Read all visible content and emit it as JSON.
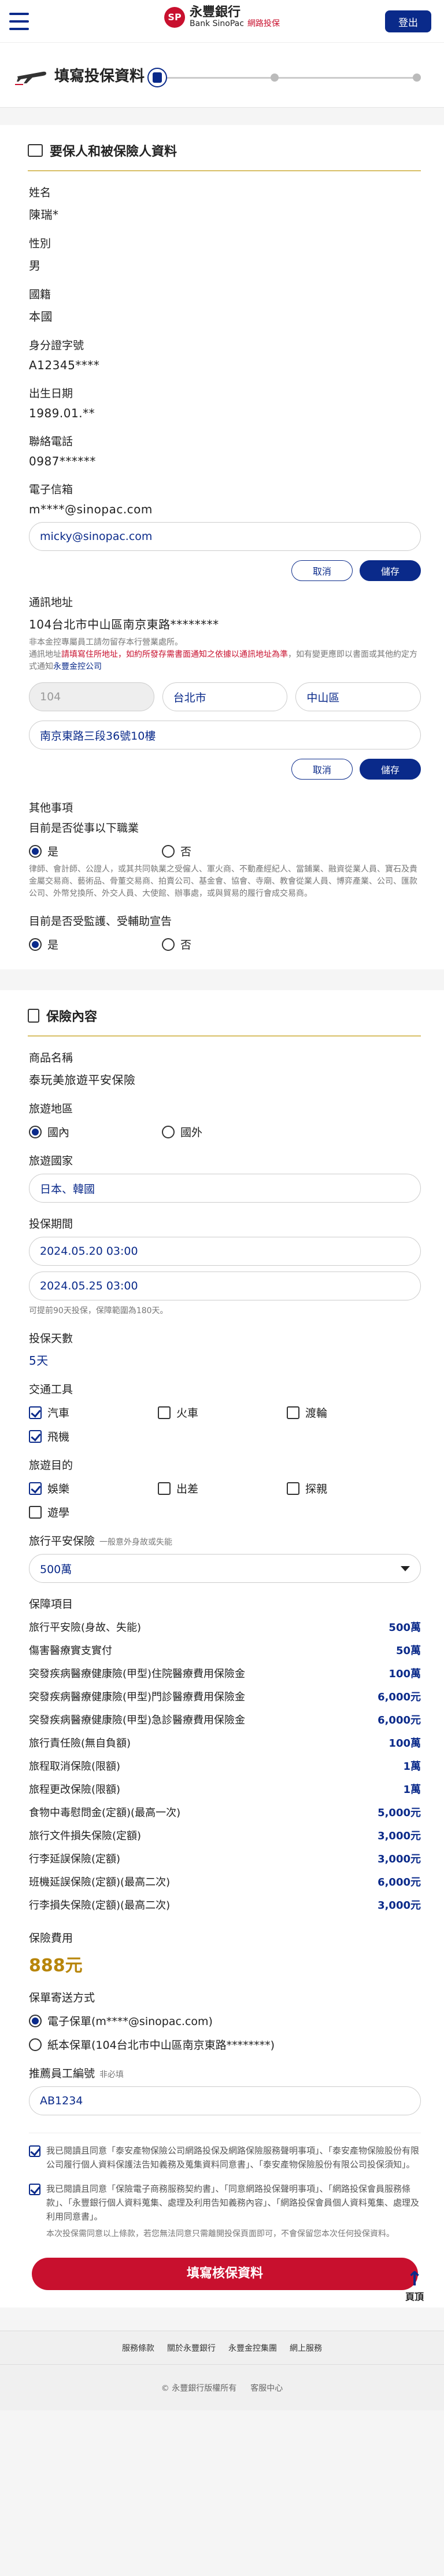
{
  "header": {
    "logo_mark": "SP",
    "bank_cn": "永豐銀行",
    "bank_en": "Bank SinoPac",
    "bank_sub": "網路投保",
    "logout": "登出"
  },
  "title": {
    "page_title": "填寫投保資料"
  },
  "applicant": {
    "section_title": "要保人和被保險人資料",
    "name_label": "姓名",
    "name": "陳瑞*",
    "gender_label": "性別",
    "gender": "男",
    "nationality_label": "國籍",
    "nationality": "本國",
    "id_label": "身分證字號",
    "id": "A12345****",
    "birth_label": "出生日期",
    "birth": "1989.01.**",
    "phone_label": "聯絡電話",
    "phone": "0987******",
    "email_label": "電子信箱",
    "email_masked": "m****@sinopac.com",
    "email_input": "micky@sinopac.com",
    "cancel": "取消",
    "save": "儲存",
    "address_label": "通訊地址",
    "address": "104台北市中山區南京東路********",
    "address_note1": "非本金控專屬員工請勿留存本行營業處所。",
    "address_note2": "通訊地址",
    "address_note_red": "請填寫住所地址，如約所發存需書面通知之依據以通訊地址為準",
    "address_note3": "，如有變更應即以書面或其他約定方式通知",
    "address_note_blue": "永豐金控公司",
    "postal": "104",
    "city": "台北市",
    "district": "中山區",
    "street": "南京東路三段36號10樓"
  },
  "other": {
    "title": "其他事項",
    "q1": "目前是否從事以下職業",
    "yes": "是",
    "no": "否",
    "q1_note": "律師、會計師、公證人，或其共同執業之受僱人、軍火商、不動產經紀人、當鋪業、融資從業人員、寶石及貴金屬交易商、藝術品、骨董交易商、拍賣公司、基金會、協會、寺廟、教會從業人員、博弈產業、公司、匯款公司、外幣兌換所、外交人員、大使館、辦事處，或與貿易的履行會成交易商。",
    "q2": "目前是否受監護、受輔助宣告"
  },
  "insurance": {
    "section_title": "保險內容",
    "product_label": "商品名稱",
    "product": "泰玩美旅遊平安保險",
    "region_label": "旅遊地區",
    "domestic": "國內",
    "abroad": "國外",
    "country_label": "旅遊國家",
    "country": "日本、韓國",
    "period_label": "投保期間",
    "start": "2024.05.20 03:00",
    "end": "2024.05.25 03:00",
    "period_note": "可提前90天投保，保障範圍為180天。",
    "days_label": "投保天數",
    "days": "5天",
    "transport_label": "交通工具",
    "transport": [
      {
        "label": "汽車",
        "on": true
      },
      {
        "label": "火車",
        "on": false
      },
      {
        "label": "渡輪",
        "on": false
      },
      {
        "label": "飛機",
        "on": true
      }
    ],
    "purpose_label": "旅遊目的",
    "purpose": [
      {
        "label": "娛樂",
        "on": true
      },
      {
        "label": "出差",
        "on": false
      },
      {
        "label": "探親",
        "on": false
      },
      {
        "label": "遊學",
        "on": false
      }
    ],
    "amount_label": "旅行平安保險",
    "amount_hint": "一般意外身故或失能",
    "amount": "500萬",
    "coverage_label": "保障項目",
    "coverage": [
      {
        "name": "旅行平安險(身故、失能)",
        "amt": "500萬"
      },
      {
        "name": "傷害醫療實支實付",
        "amt": "50萬"
      },
      {
        "name": "突發疾病醫療健康險(甲型)住院醫療費用保險金",
        "amt": "100萬"
      },
      {
        "name": "突發疾病醫療健康險(甲型)門診醫療費用保險金",
        "amt": "6,000元"
      },
      {
        "name": "突發疾病醫療健康險(甲型)急診醫療費用保險金",
        "amt": "6,000元"
      },
      {
        "name": "旅行責任險(無自負額)",
        "amt": "100萬"
      },
      {
        "name": "旅程取消保險(限額)",
        "amt": "1萬"
      },
      {
        "name": "旅程更改保險(限額)",
        "amt": "1萬"
      },
      {
        "name": "食物中毒慰問金(定額)(最高一次)",
        "amt": "5,000元"
      },
      {
        "name": "旅行文件損失保險(定額)",
        "amt": "3,000元"
      },
      {
        "name": "行李延誤保險(定額)",
        "amt": "3,000元"
      },
      {
        "name": "班機延誤保險(定額)(最高二次)",
        "amt": "6,000元"
      },
      {
        "name": "行李損失保險(定額)(最高二次)",
        "amt": "3,000元"
      }
    ],
    "fee_label": "保險費用",
    "fee": "888元",
    "delivery_label": "保單寄送方式",
    "delivery_e": "電子保單(m****@sinopac.com)",
    "delivery_p": "紙本保單(104台北市中山區南京東路********)",
    "referrer_label": "推薦員工編號",
    "referrer_hint": "非必填",
    "referrer": "AB1234",
    "agree1": "我已閱讀且同意「泰安產物保險公司網路投保及網路保險服務聲明事項」、「泰安產物保險股份有限公司履行個人資料保護法告知義務及蒐集資料同意書」、「泰安產物保險股份有限公司投保須知」。",
    "agree2": "我已閱讀且同意「保險電子商務服務契約書」、「同意網路投保聲明事項」、「網路投保會員服務條款」、「永豐銀行個人資料蒐集、處理及利用告知義務內容」、「網路投保會員個人資料蒐集、處理及利用同意書」。",
    "agree_note": "本次投保需同意以上條款，若您無法同意只需離開投保頁面即可，不會保留您本次任何投保資料。",
    "submit": "填寫核保資料",
    "top": "頁頂"
  },
  "footer": {
    "links": [
      "服務條款",
      "關於永豐銀行",
      "永豐金控集團",
      "網上服務"
    ],
    "copyright": "© 永豐銀行版權所有",
    "service": "客服中心"
  }
}
